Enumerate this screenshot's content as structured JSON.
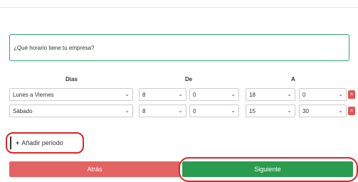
{
  "question": {
    "label": "¿Qué horario tiene tu empresa?"
  },
  "headers": {
    "dias": "Dias",
    "de": "De",
    "a": "A"
  },
  "rows": [
    {
      "day": "Lunes a Viernes",
      "from_hour": "8",
      "from_min": "0",
      "to_hour": "18",
      "to_min": "0",
      "delete": "×"
    },
    {
      "day": "Sábado",
      "from_hour": "8",
      "from_min": "0",
      "to_hour": "15",
      "to_min": "30",
      "delete": "×"
    }
  ],
  "add_period": {
    "plus": "+",
    "label": "Añadir periodo"
  },
  "buttons": {
    "back": "Atrás",
    "next": "Siguiente"
  },
  "colors": {
    "accent_green": "#2a9c4f",
    "danger_red": "#e36263",
    "highlight_red": "#d9252a"
  }
}
